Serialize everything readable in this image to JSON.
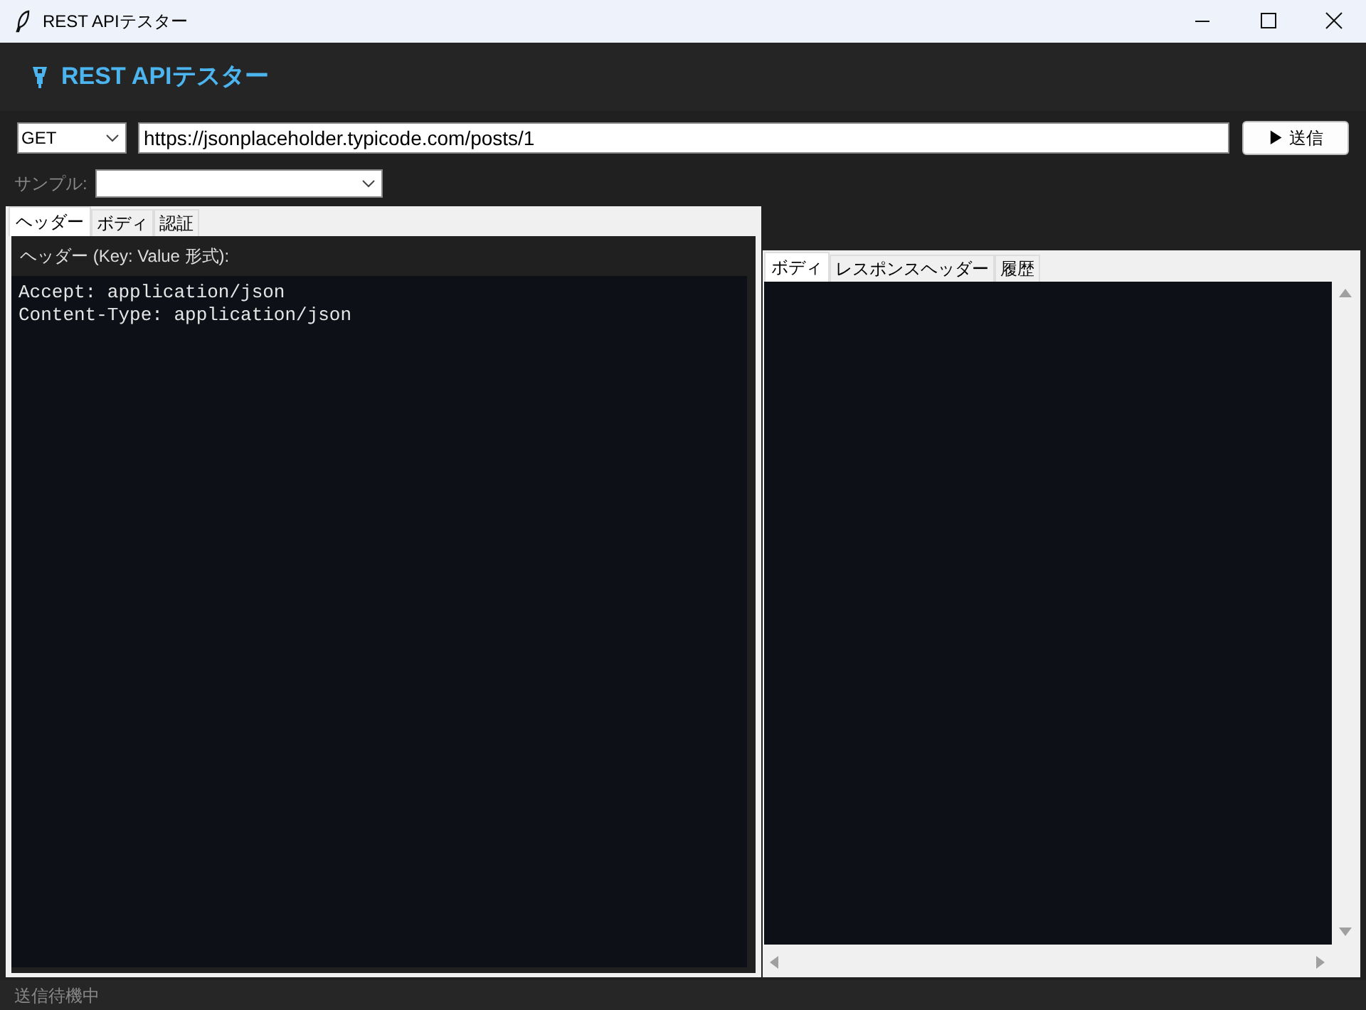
{
  "window": {
    "title": "REST APIテスター"
  },
  "app_header": {
    "title": "REST APIテスター"
  },
  "request": {
    "method": "GET",
    "url": "https://jsonplaceholder.typicode.com/posts/1",
    "send_button": "▶ 送信"
  },
  "sample": {
    "label": "サンプル:"
  },
  "request_tabs": [
    {
      "label": "ヘッダー",
      "selected": true
    },
    {
      "label": "ボディ",
      "selected": false
    },
    {
      "label": "認証",
      "selected": false
    }
  ],
  "headers_panel": {
    "label": "ヘッダー (Key: Value 形式):",
    "lines": [
      "Accept: application/json",
      "Content-Type: application/json"
    ]
  },
  "response_tabs": [
    {
      "label": "ボディ",
      "selected": true
    },
    {
      "label": "レスポンスヘッダー",
      "selected": false
    },
    {
      "label": "履歴",
      "selected": false
    }
  ],
  "status_bar": {
    "text": "送信待機中"
  }
}
